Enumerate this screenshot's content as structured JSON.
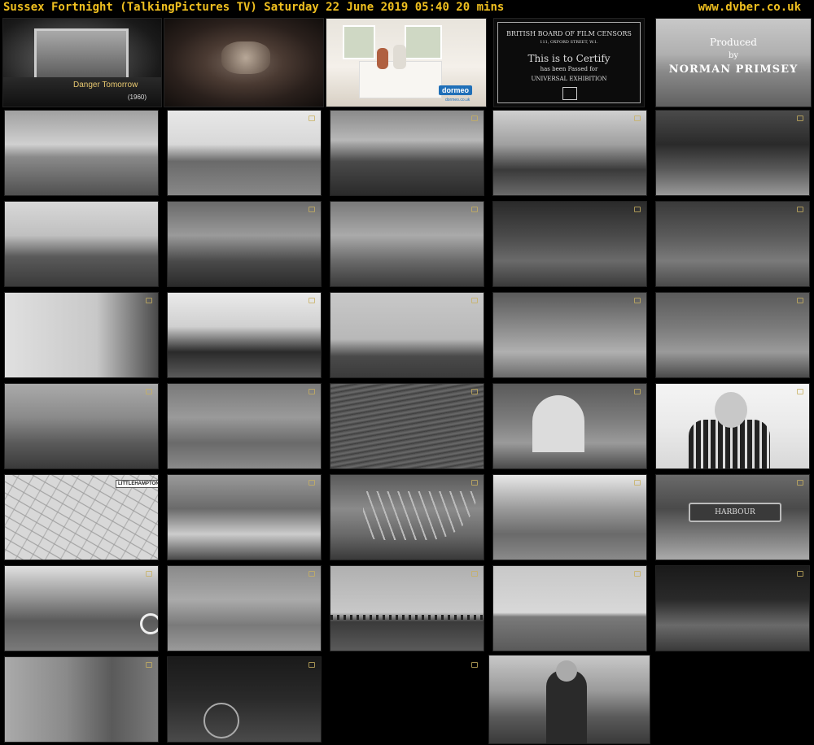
{
  "header": {
    "title": "Sussex Fortnight (TalkingPictures TV)   Saturday 22 June 2019  05:40  20 mins",
    "site": "www.dvber.co.uk"
  },
  "frames": [
    {
      "caption": "Danger Tomorrow",
      "year": "(1960)"
    },
    {},
    {
      "brand": "dormeo",
      "brand_sub": "dormeo.co.uk"
    },
    {
      "cert_line1": "BRITISH BOARD OF FILM CENSORS",
      "cert_line2": "111, OXFORD STREET, W.1.",
      "cert_line3": "This is to Certify",
      "cert_line4": "has been Passed for",
      "cert_line5": "UNIVERSAL EXHIBITION"
    },
    {
      "p1": "Produced",
      "p2": "by",
      "p3": "NORMAN PRIMSEY"
    },
    {},
    {},
    {},
    {},
    {},
    {},
    {},
    {},
    {},
    {},
    {},
    {},
    {},
    {},
    {},
    {},
    {},
    {},
    {},
    {},
    {
      "map_label": "LITTLEHAMPTON"
    },
    {},
    {},
    {},
    {
      "sign": "HARBOUR"
    },
    {},
    {},
    {},
    {},
    {},
    {},
    {},
    {},
    {}
  ],
  "colors": {
    "header_text": "#f0c020",
    "background": "#000000"
  }
}
